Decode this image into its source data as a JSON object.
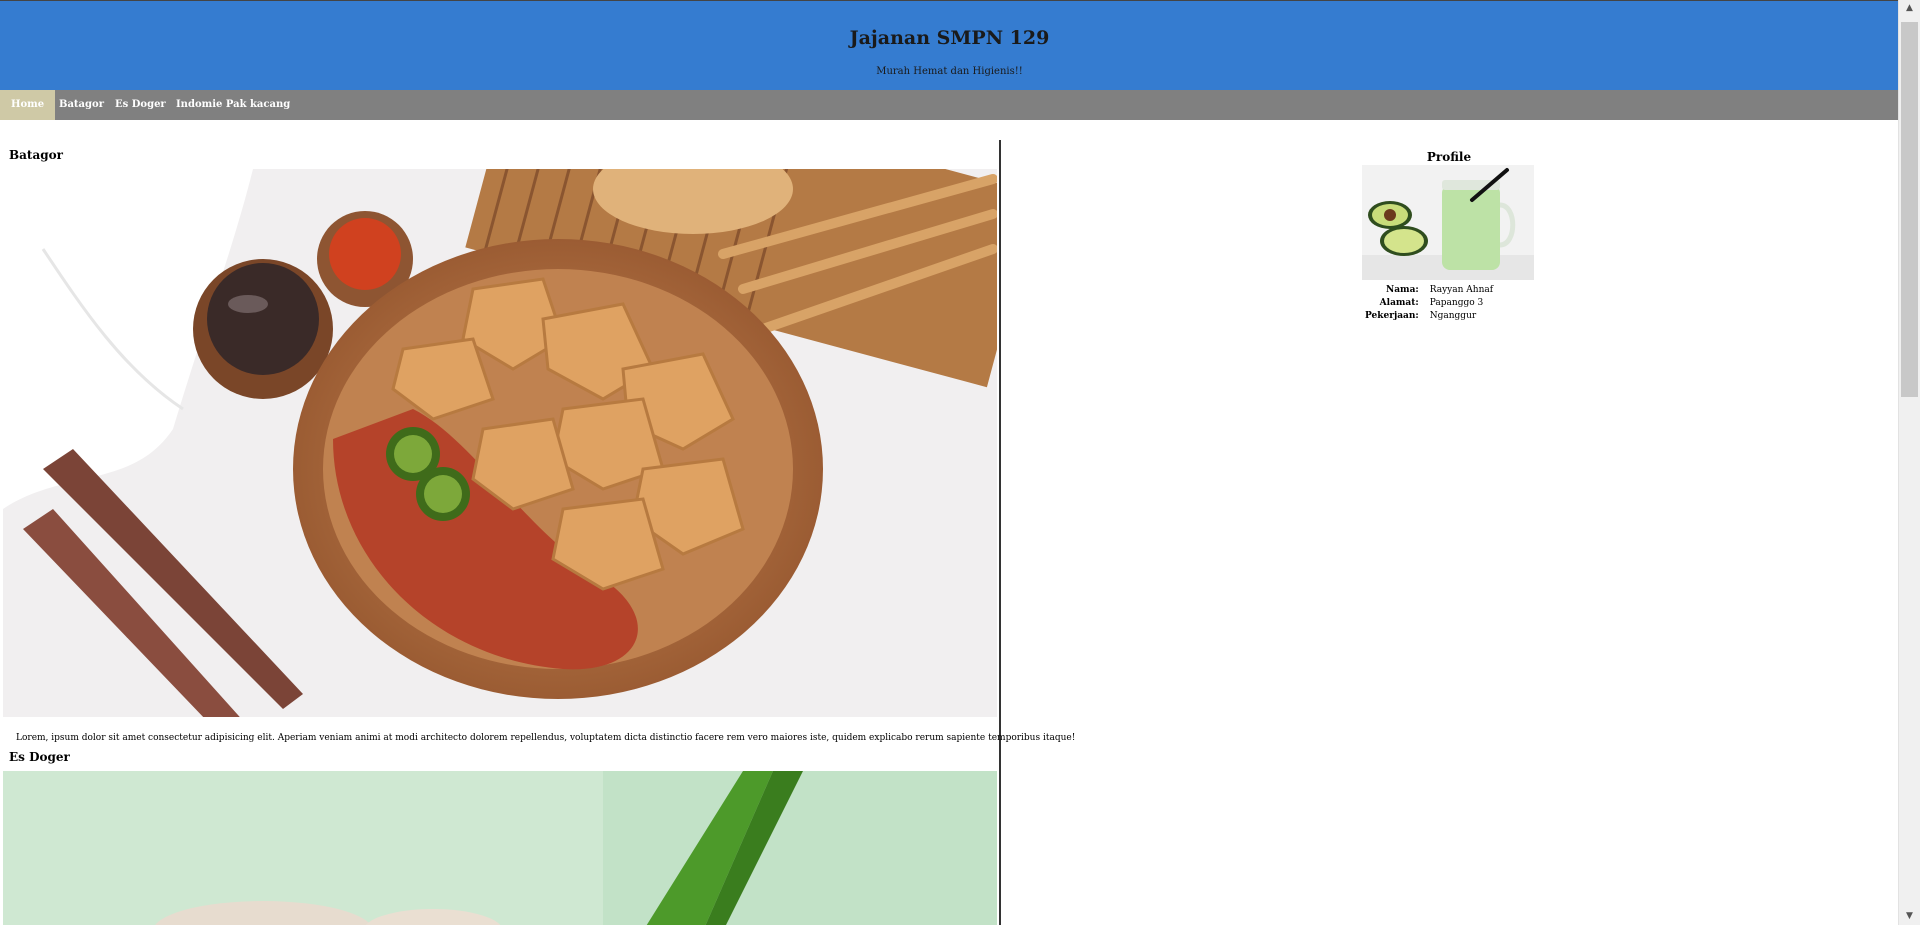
{
  "header": {
    "title": "Jajanan SMPN 129",
    "subtitle": "Murah Hemat dan Higienis!!"
  },
  "nav": {
    "items": [
      {
        "label": "Home",
        "active": true
      },
      {
        "label": "Batagor"
      },
      {
        "label": "Es Doger"
      },
      {
        "label": "Indomie Pak kacang"
      }
    ]
  },
  "main": {
    "sections": [
      {
        "title": "Batagor",
        "image": "batagor-photo",
        "text": "Lorem, ipsum dolor sit amet consectetur adipisicing elit. Aperiam veniam animi at modi architecto dolorem repellendus, voluptatem dicta distinctio facere rem vero maiores iste, quidem explicabo rerum sapiente temporibus itaque!"
      },
      {
        "title": "Es Doger",
        "image": "es-doger-photo"
      }
    ]
  },
  "profile": {
    "title": "Profile",
    "image": "avocado-juice-photo",
    "rows": [
      {
        "key": "Nama:",
        "value": "Rayyan Ahnaf"
      },
      {
        "key": "Alamat:",
        "value": "Papanggo 3"
      },
      {
        "key": "Pekerjaan:",
        "value": "Nganggur"
      }
    ]
  },
  "colors": {
    "header_bg": "#357cd0",
    "nav_bg": "#808080",
    "nav_active_bg": "#cfc9a6"
  }
}
